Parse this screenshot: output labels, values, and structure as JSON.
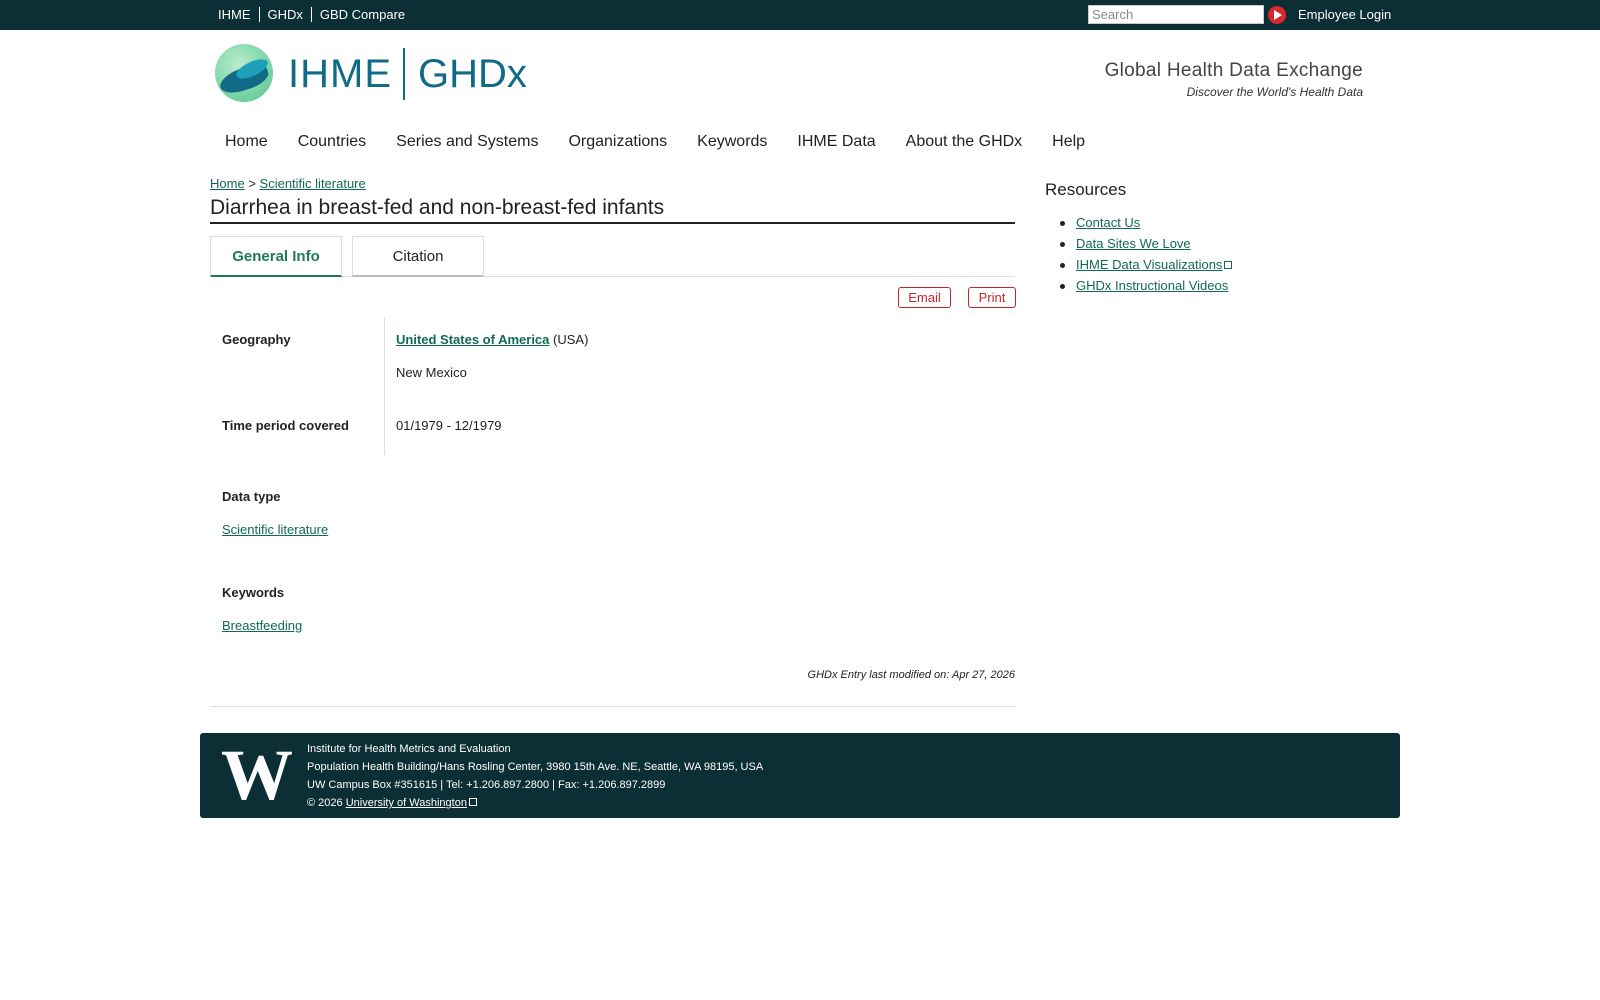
{
  "topbar": {
    "links": [
      "IHME",
      "GHDx",
      "GBD Compare"
    ],
    "search_placeholder": "Search",
    "login_label": "Employee Login"
  },
  "header": {
    "logo_ihme": "IHME",
    "logo_ghdx": "GHDx",
    "tagline_title": "Global Health Data Exchange",
    "tagline_sub": "Discover the World's Health Data"
  },
  "nav": {
    "items": [
      "Home",
      "Countries",
      "Series and Systems",
      "Organizations",
      "Keywords",
      "IHME Data",
      "About the GHDx",
      "Help"
    ]
  },
  "breadcrumb": {
    "home": "Home",
    "separator": ">",
    "current": "Scientific literature"
  },
  "page": {
    "title": "Diarrhea in breast-fed and non-breast-fed infants",
    "tabs": [
      "General Info",
      "Citation"
    ],
    "email_label": "Email",
    "print_label": "Print"
  },
  "fields": {
    "geography_label": "Geography",
    "geography_country": "United States of America",
    "geography_code": "(USA)",
    "geography_region": "New Mexico",
    "time_label": "Time period covered",
    "time_value": "01/1979 - 12/1979",
    "datatype_label": "Data type",
    "datatype_value": "Scientific literature",
    "keywords_label": "Keywords",
    "keywords_value": "Breastfeeding",
    "modified": "GHDx Entry last modified on: Apr 27, 2026"
  },
  "sidebar": {
    "title": "Resources",
    "items": [
      "Contact Us",
      "Data Sites We Love",
      "IHME Data Visualizations",
      "GHDx Instructional Videos"
    ]
  },
  "footer": {
    "logo_letter": "W",
    "line1": "Institute for Health Metrics and Evaluation",
    "line2": "Population Health Building/Hans Rosling Center, 3980 15th Ave. NE, Seattle, WA 98195, USA",
    "line3": "UW Campus Box #351615 | Tel: +1.206.897.2800 | Fax: +1.206.897.2899",
    "copyright": "© 2026",
    "uw_link": "University of Washington"
  },
  "colors": {
    "topbar_bg": "#0c2f35",
    "link_green": "#116a55",
    "brand_blue": "#116a86",
    "accent_red": "#c0272d"
  }
}
